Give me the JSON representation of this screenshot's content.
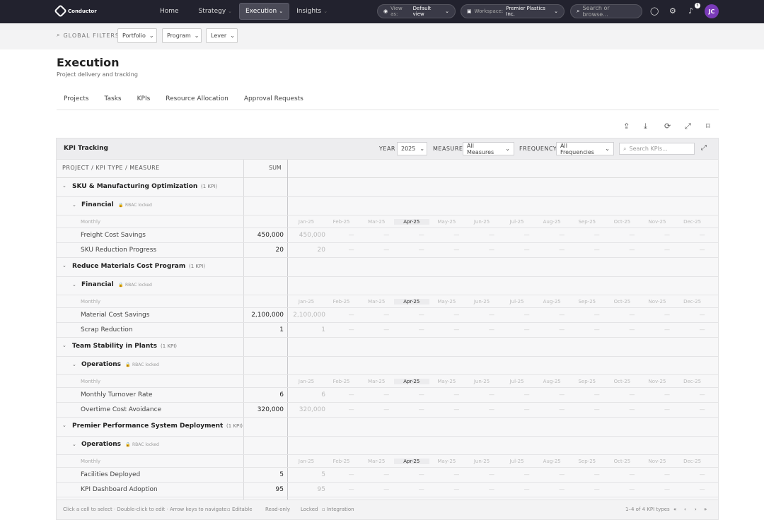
{
  "app": {
    "name": "Conductor"
  },
  "nav": {
    "items": [
      {
        "label": "Home"
      },
      {
        "label": "Strategy"
      },
      {
        "label": "Execution"
      },
      {
        "label": "Insights"
      }
    ]
  },
  "top": {
    "view_label": "View as:",
    "view_value": "Default view",
    "workspace_label": "Workspace:",
    "workspace_value": "Premier Plastics Inc.",
    "search_placeholder": "Search or browse...",
    "notif_count": "5",
    "avatar": "JC"
  },
  "filters": {
    "label": "GLOBAL FILTERS",
    "items": [
      "Portfolio",
      "Program",
      "Lever"
    ]
  },
  "page": {
    "title": "Execution",
    "subtitle": "Project delivery and tracking"
  },
  "tabs": [
    "Projects",
    "Tasks",
    "KPIs",
    "Resource Allocation",
    "Approval Requests"
  ],
  "panel": {
    "title": "KPI Tracking",
    "year_label": "YEAR",
    "year": "2025",
    "measure_label": "MEASURE",
    "measure": "All Measures",
    "freq_label": "FREQUENCY",
    "freq": "All Frequencies",
    "search_placeholder": "Search KPIs..."
  },
  "columns": {
    "left": "PROJECT / KPI TYPE / MEASURE",
    "sum": "SUM",
    "months": [
      "Jan-25",
      "Feb-25",
      "Mar-25",
      "Apr-25",
      "May-25",
      "Jun-25",
      "Jul-25",
      "Aug-25",
      "Sep-25",
      "Oct-25",
      "Nov-25",
      "Dec-25"
    ]
  },
  "groups": [
    {
      "project": "SKU & Manufacturing Optimization",
      "count": "(1 KPI)",
      "type": "Financial",
      "lock": "RBAC locked",
      "freq": "Monthly",
      "kpis": [
        {
          "name": "Freight Cost Savings",
          "sum": "450,000",
          "jan": "450,000"
        },
        {
          "name": "SKU Reduction Progress",
          "sum": "20",
          "jan": "20"
        }
      ]
    },
    {
      "project": "Reduce Materials Cost Program",
      "count": "(1 KPI)",
      "type": "Financial",
      "lock": "RBAC locked",
      "freq": "Monthly",
      "kpis": [
        {
          "name": "Material Cost Savings",
          "sum": "2,100,000",
          "jan": "2,100,000"
        },
        {
          "name": "Scrap Reduction",
          "sum": "1",
          "jan": "1"
        }
      ]
    },
    {
      "project": "Team Stability in Plants",
      "count": "(1 KPI)",
      "type": "Operations",
      "lock": "RBAC locked",
      "freq": "Monthly",
      "kpis": [
        {
          "name": "Monthly Turnover Rate",
          "sum": "6",
          "jan": "6"
        },
        {
          "name": "Overtime Cost Avoidance",
          "sum": "320,000",
          "jan": "320,000"
        }
      ]
    },
    {
      "project": "Premier Performance System Deployment",
      "count": "(1 KPI)",
      "type": "Operations",
      "lock": "RBAC locked",
      "freq": "Monthly",
      "kpis": [
        {
          "name": "Facilities Deployed",
          "sum": "5",
          "jan": "5"
        },
        {
          "name": "KPI Dashboard Adoption",
          "sum": "95",
          "jan": "95"
        }
      ]
    }
  ],
  "footer": {
    "hint": "Click a cell to select · Double-click to edit · Arrow keys to navigate",
    "legend": [
      "Editable",
      "Read-only",
      "Locked",
      "Integration"
    ],
    "pager": "1–4 of 4 KPI types"
  }
}
